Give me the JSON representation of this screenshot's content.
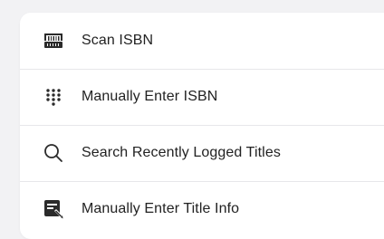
{
  "menu": {
    "items": [
      {
        "label": "Scan ISBN",
        "icon": "barcode-icon"
      },
      {
        "label": "Manually Enter ISBN",
        "icon": "keypad-icon"
      },
      {
        "label": "Search Recently Logged Titles",
        "icon": "search-icon"
      },
      {
        "label": "Manually Enter Title Info",
        "icon": "edit-form-icon"
      }
    ]
  },
  "colors": {
    "background": "#f2f2f4",
    "card": "#ffffff",
    "text": "#222222",
    "icon": "#2b2b2b",
    "divider": "#e7e7ea"
  }
}
